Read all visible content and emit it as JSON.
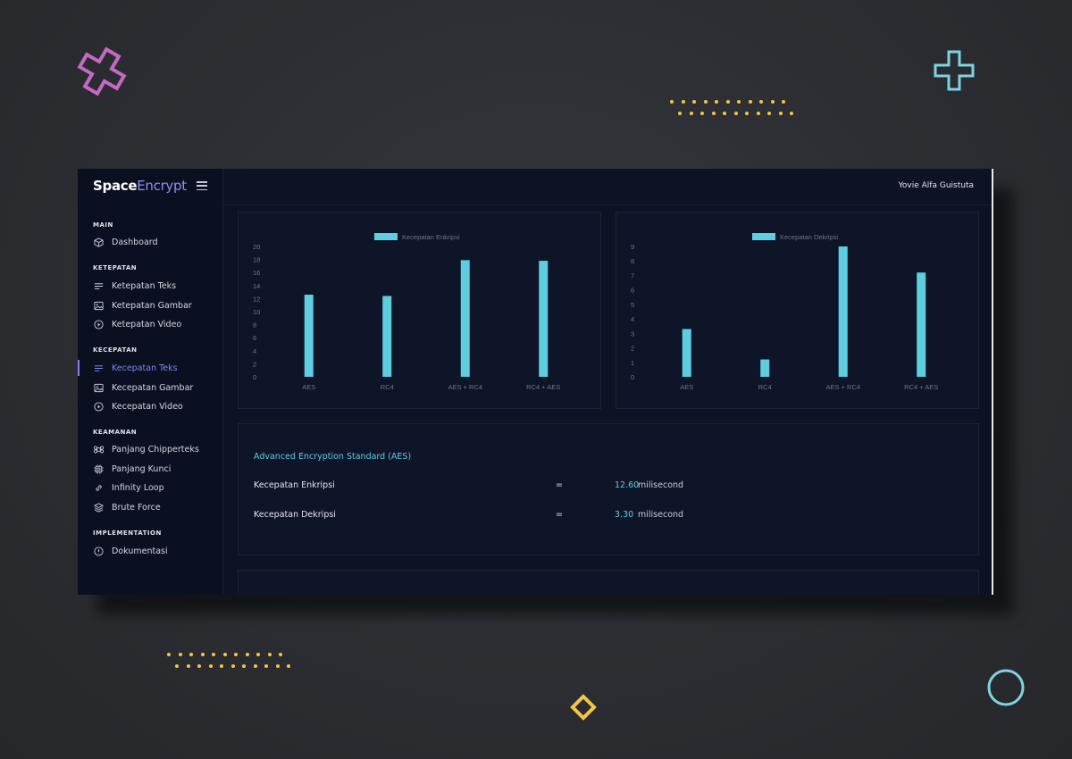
{
  "app": {
    "brand_bold": "Space",
    "brand_light": "Encrypt",
    "user_name": "Yovie Alfa Guistuta"
  },
  "sidebar": {
    "sections": [
      {
        "title": "MAIN",
        "items": [
          {
            "label": "Dashboard",
            "icon": "cube-icon"
          }
        ]
      },
      {
        "title": "KETEPATAN",
        "items": [
          {
            "label": "Ketepatan Teks",
            "icon": "text-lines-icon"
          },
          {
            "label": "Ketepatan Gambar",
            "icon": "image-icon"
          },
          {
            "label": "Ketepatan Video",
            "icon": "play-circle-icon"
          }
        ]
      },
      {
        "title": "KECEPATAN",
        "items": [
          {
            "label": "Kecepatan Teks",
            "icon": "text-lines-icon",
            "active": true
          },
          {
            "label": "Kecepatan Gambar",
            "icon": "image-icon"
          },
          {
            "label": "Kecepatan Video",
            "icon": "play-circle-icon"
          }
        ]
      },
      {
        "title": "KEAMANAN",
        "items": [
          {
            "label": "Panjang Chipperteks",
            "icon": "command-icon"
          },
          {
            "label": "Panjang Kunci",
            "icon": "cpu-icon"
          },
          {
            "label": "Infinity Loop",
            "icon": "link-icon"
          },
          {
            "label": "Brute Force",
            "icon": "layers-icon"
          }
        ]
      },
      {
        "title": "IMPLEMENTATION",
        "items": [
          {
            "label": "Dokumentasi",
            "icon": "info-circle-icon"
          }
        ]
      }
    ]
  },
  "chart_data": [
    {
      "type": "bar",
      "categories": [
        "AES",
        "RC4",
        "AES + RC4",
        "RC4 + AES"
      ],
      "series": [
        {
          "name": "Kecepatan Enkripsi",
          "values": [
            12.6,
            12.4,
            17.9,
            17.8
          ]
        }
      ],
      "yticks": [
        0,
        2,
        4,
        6,
        8,
        10,
        12,
        14,
        16,
        18,
        20
      ],
      "ylim": [
        0,
        20
      ],
      "legend": "top-center",
      "grid": false,
      "color": "#5ecde0"
    },
    {
      "type": "bar",
      "categories": [
        "AES",
        "RC4",
        "AES + RC4",
        "RC4 + AES"
      ],
      "series": [
        {
          "name": "Kecepatan Dekripsi",
          "values": [
            3.3,
            1.2,
            9.0,
            7.2
          ]
        }
      ],
      "yticks": [
        0,
        1,
        2,
        3,
        4,
        5,
        6,
        7,
        8,
        9
      ],
      "ylim": [
        0,
        9
      ],
      "legend": "top-center",
      "grid": false,
      "color": "#5ecde0"
    }
  ],
  "info": {
    "title": "Advanced Encryption Standard (AES)",
    "rows": [
      {
        "label": "Kecepatan Enkripsi",
        "eq": "=",
        "value": "12.60",
        "unit": "milisecond"
      },
      {
        "label": "Kecepatan Dekripsi",
        "eq": "=",
        "value": "3.30",
        "unit": "milisecond"
      }
    ]
  },
  "colors": {
    "accent": "#5ecde0",
    "active": "#7f86f2",
    "panel": "#0f1529",
    "background": "#2b2d32"
  }
}
